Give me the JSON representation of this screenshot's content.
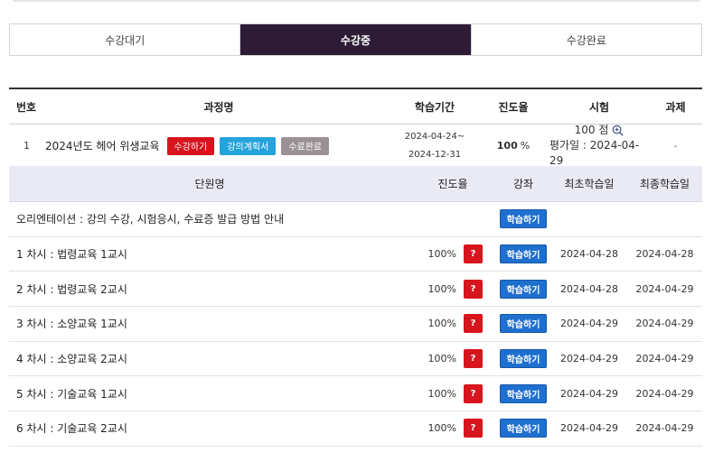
{
  "tabs": [
    {
      "label": "수강대기",
      "active": false
    },
    {
      "label": "수강중",
      "active": true
    },
    {
      "label": "수강완료",
      "active": false
    }
  ],
  "course_table": {
    "headers": {
      "no": "번호",
      "name": "과정명",
      "period": "학습기간",
      "rate": "진도율",
      "exam": "시험",
      "task": "과제"
    },
    "row": {
      "no": "1",
      "title": "2024년도 헤어 위생교육",
      "btn_enroll": "수강하기",
      "btn_plan": "강의계획서",
      "btn_complete": "수료완료",
      "period_start": "2024-04-24~",
      "period_end": "2024-12-31",
      "rate_value": "100",
      "rate_unit": "%",
      "exam_score": "100 점",
      "exam_date": "평가일 : 2024-04-29",
      "task": "-"
    }
  },
  "unit_table": {
    "headers": {
      "name": "단원명",
      "rate": "진도율",
      "lecture": "강좌",
      "first": "최초학습일",
      "last": "최종학습일"
    },
    "rows": [
      {
        "name": "오리엔테이션 : 강의 수강, 시험응시, 수료증 발급 방법 안내",
        "rate": "",
        "study": "학습하기",
        "first": "",
        "last": ""
      },
      {
        "name": "1 차시 : 법령교육 1교시",
        "rate": "100%",
        "quiz": "?",
        "study": "학습하기",
        "first": "2024-04-28",
        "last": "2024-04-28"
      },
      {
        "name": "2 차시 : 법령교육 2교시",
        "rate": "100%",
        "quiz": "?",
        "study": "학습하기",
        "first": "2024-04-28",
        "last": "2024-04-29"
      },
      {
        "name": "3 차시 : 소양교육 1교시",
        "rate": "100%",
        "quiz": "?",
        "study": "학습하기",
        "first": "2024-04-29",
        "last": "2024-04-29"
      },
      {
        "name": "4 차시 : 소양교육 2교시",
        "rate": "100%",
        "quiz": "?",
        "study": "학습하기",
        "first": "2024-04-29",
        "last": "2024-04-29"
      },
      {
        "name": "5 차시 : 기술교육 1교시",
        "rate": "100%",
        "quiz": "?",
        "study": "학습하기",
        "first": "2024-04-29",
        "last": "2024-04-29"
      },
      {
        "name": "6 차시 : 기술교육 2교시",
        "rate": "100%",
        "quiz": "?",
        "study": "학습하기",
        "first": "2024-04-29",
        "last": "2024-04-29"
      }
    ]
  },
  "icons": {
    "zoom": "magnifier-plus-icon"
  },
  "colors": {
    "active_tab": "#2e1c36",
    "enroll_btn": "#d8141d",
    "plan_btn": "#25a3dc",
    "complete_btn": "#9a9196",
    "study_btn": "#1f6fcf",
    "unit_header_bg": "#eaeaf4"
  }
}
